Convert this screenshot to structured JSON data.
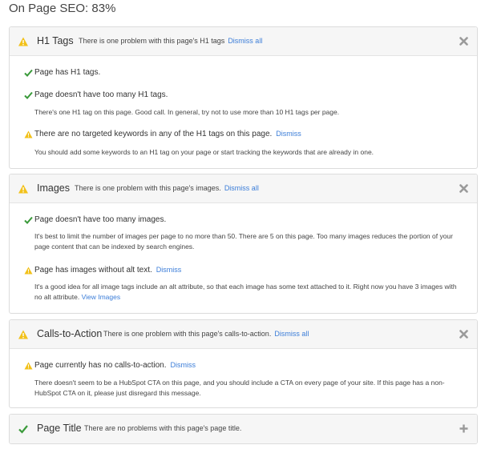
{
  "page": {
    "title": "On Page SEO: 83%"
  },
  "colors": {
    "warning": "#f2c11a",
    "check": "#3a9a3a",
    "link": "#3b7dd8",
    "close": "#9a9a9a"
  },
  "sections": [
    {
      "title": "H1 Tags",
      "status_icon": "warning-icon",
      "summary": "There is one problem with this page's H1 tags",
      "dismiss_all": "Dismiss all",
      "header_action_icon": "close-icon",
      "items": [
        {
          "icon": "check-icon",
          "text": "Page has H1 tags."
        },
        {
          "icon": "check-icon",
          "text": "Page doesn't have too many H1 tags.",
          "description": "There's one H1 tag on this page. Good call. In general, try not to use more than 10 H1 tags per page."
        },
        {
          "icon": "warning-icon",
          "text": "There are no targeted keywords in any of the H1 tags on this page.",
          "dismiss": "Dismiss",
          "description": "You should add some keywords to an H1 tag on your page or start tracking the keywords that are already in one."
        }
      ]
    },
    {
      "title": "Images",
      "status_icon": "warning-icon",
      "summary": "There is one problem with this page's images.",
      "dismiss_all": "Dismiss all",
      "header_action_icon": "close-icon",
      "items": [
        {
          "icon": "check-icon",
          "text": "Page doesn't have too many images.",
          "description_line1": "It's best to limit the number of images per page to no more than 50. There are 5 on this page. Too many images reduces the portion of your",
          "description_line2": "page content that can be indexed by search engines."
        },
        {
          "icon": "warning-icon",
          "text": "Page has images without alt text.",
          "dismiss": "Dismiss",
          "description_line1": "It's a good idea for all image tags include an alt attribute, so that each image has some text attached to it. Right now you have 3 images with",
          "description_line2": "no alt attribute.",
          "view_link": "View Images"
        }
      ]
    },
    {
      "title": "Calls-to-Action",
      "status_icon": "warning-icon",
      "summary": "There is one problem with this page's calls-to-action.",
      "dismiss_all": "Dismiss all",
      "header_action_icon": "close-icon",
      "items": [
        {
          "icon": "warning-icon",
          "text": "Page currently has no calls-to-action.",
          "dismiss": "Dismiss",
          "description_line1": "There doesn't seem to be a HubSpot CTA on this page, and you should include a CTA on every page of your site. If this page has a non-",
          "description_line2": "HubSpot CTA on it, please just disregard this message."
        }
      ]
    },
    {
      "title": "Page Title",
      "status_icon": "check-icon",
      "summary": "There are no problems with this page's page title.",
      "header_action_icon": "plus-icon"
    }
  ]
}
